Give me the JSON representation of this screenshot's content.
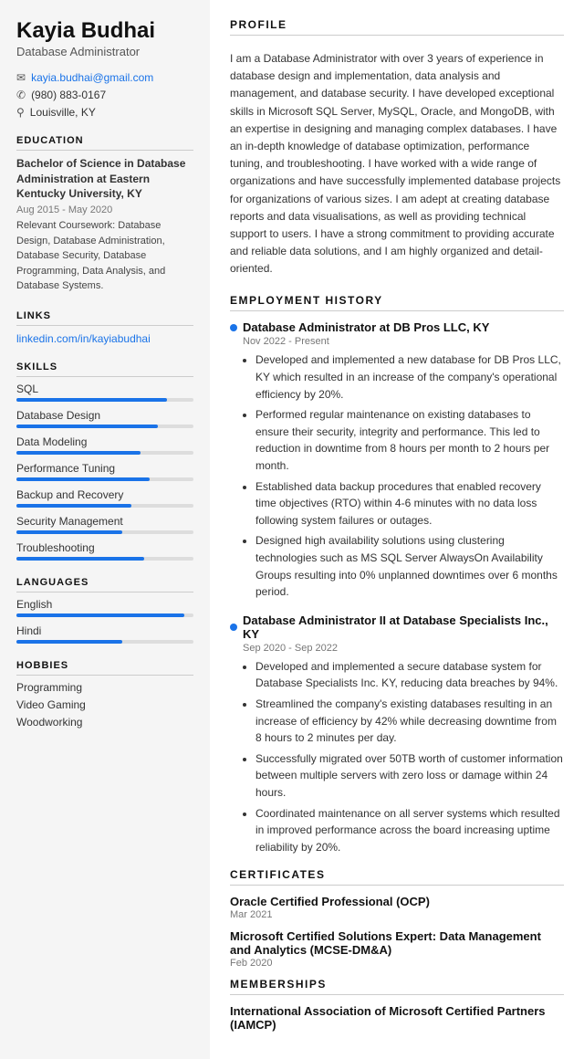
{
  "sidebar": {
    "name": "Kayia Budhai",
    "title": "Database Administrator",
    "contact": {
      "email": "kayia.budhai@gmail.com",
      "phone": "(980) 883-0167",
      "location": "Louisville, KY"
    },
    "education": {
      "degree": "Bachelor of Science in Database Administration at Eastern Kentucky University, KY",
      "date": "Aug 2015 - May 2020",
      "courses": "Relevant Coursework: Database Design, Database Administration, Database Security, Database Programming, Data Analysis, and Database Systems."
    },
    "links": {
      "linkedin": "linkedin.com/in/kayiabudhai"
    },
    "skills": [
      {
        "label": "SQL",
        "pct": 85
      },
      {
        "label": "Database Design",
        "pct": 80
      },
      {
        "label": "Data Modeling",
        "pct": 70
      },
      {
        "label": "Performance Tuning",
        "pct": 75
      },
      {
        "label": "Backup and Recovery",
        "pct": 65
      },
      {
        "label": "Security Management",
        "pct": 60
      },
      {
        "label": "Troubleshooting",
        "pct": 72
      }
    ],
    "languages": [
      {
        "label": "English",
        "pct": 95
      },
      {
        "label": "Hindi",
        "pct": 60
      }
    ],
    "hobbies": [
      "Programming",
      "Video Gaming",
      "Woodworking"
    ],
    "section_labels": {
      "education": "EDUCATION",
      "links": "LINKS",
      "skills": "SKILLS",
      "languages": "LANGUAGES",
      "hobbies": "HOBBIES"
    }
  },
  "main": {
    "section_labels": {
      "profile": "PROFILE",
      "employment": "EMPLOYMENT HISTORY",
      "certificates": "CERTIFICATES",
      "memberships": "MEMBERSHIPS"
    },
    "profile": "I am a Database Administrator with over 3 years of experience in database design and implementation, data analysis and management, and database security. I have developed exceptional skills in Microsoft SQL Server, MySQL, Oracle, and MongoDB, with an expertise in designing and managing complex databases. I have an in-depth knowledge of database optimization, performance tuning, and troubleshooting. I have worked with a wide range of organizations and have successfully implemented database projects for organizations of various sizes. I am adept at creating database reports and data visualisations, as well as providing technical support to users. I have a strong commitment to providing accurate and reliable data solutions, and I am highly organized and detail-oriented.",
    "jobs": [
      {
        "title": "Database Administrator at DB Pros LLC, KY",
        "date": "Nov 2022 - Present",
        "bullets": [
          "Developed and implemented a new database for DB Pros LLC, KY which resulted in an increase of the company's operational efficiency by 20%.",
          "Performed regular maintenance on existing databases to ensure their security, integrity and performance. This led to reduction in downtime from 8 hours per month to 2 hours per month.",
          "Established data backup procedures that enabled recovery time objectives (RTO) within 4-6 minutes with no data loss following system failures or outages.",
          "Designed high availability solutions using clustering technologies such as MS SQL Server AlwaysOn Availability Groups resulting into 0% unplanned downtimes over 6 months period."
        ]
      },
      {
        "title": "Database Administrator II at Database Specialists Inc., KY",
        "date": "Sep 2020 - Sep 2022",
        "bullets": [
          "Developed and implemented a secure database system for Database Specialists Inc. KY, reducing data breaches by 94%.",
          "Streamlined the company's existing databases resulting in an increase of efficiency by 42% while decreasing downtime from 8 hours to 2 minutes per day.",
          "Successfully migrated over 50TB worth of customer information between multiple servers with zero loss or damage within 24 hours.",
          "Coordinated maintenance on all server systems which resulted in improved performance across the board increasing uptime reliability by 20%."
        ]
      }
    ],
    "certificates": [
      {
        "name": "Oracle Certified Professional (OCP)",
        "date": "Mar 2021"
      },
      {
        "name": "Microsoft Certified Solutions Expert: Data Management and Analytics (MCSE-DM&A)",
        "date": "Feb 2020"
      }
    ],
    "memberships": [
      {
        "name": "International Association of Microsoft Certified Partners (IAMCP)"
      }
    ]
  }
}
